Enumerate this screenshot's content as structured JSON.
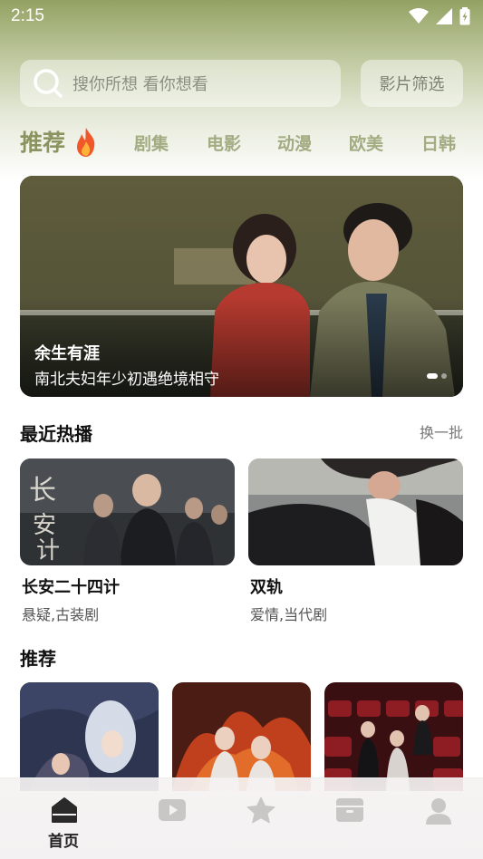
{
  "status_bar": {
    "time": "2:15"
  },
  "search": {
    "placeholder": "搜你所想 看你想看",
    "filter_label": "影片筛选"
  },
  "tabs": [
    {
      "label": "推荐"
    },
    {
      "label": "剧集"
    },
    {
      "label": "电影"
    },
    {
      "label": "动漫"
    },
    {
      "label": "欧美"
    },
    {
      "label": "日韩"
    }
  ],
  "banner": {
    "title": "余生有涯",
    "subtitle": "南北夫妇年少初遇绝境相守"
  },
  "recent_hot": {
    "title": "最近热播",
    "refresh_label": "换一批",
    "items": [
      {
        "title": "长安二十四计",
        "tags": "悬疑,古装剧"
      },
      {
        "title": "双轨",
        "tags": "爱情,当代剧"
      }
    ]
  },
  "recommend": {
    "title": "推荐"
  },
  "bottom_nav": {
    "items": [
      {
        "label": "首页",
        "icon": "home-icon"
      },
      {
        "icon": "play-icon"
      },
      {
        "icon": "star-icon"
      },
      {
        "icon": "inbox-icon"
      },
      {
        "icon": "user-icon"
      }
    ]
  },
  "colors": {
    "accent": "#8b9460",
    "header_green": "#93a263"
  }
}
